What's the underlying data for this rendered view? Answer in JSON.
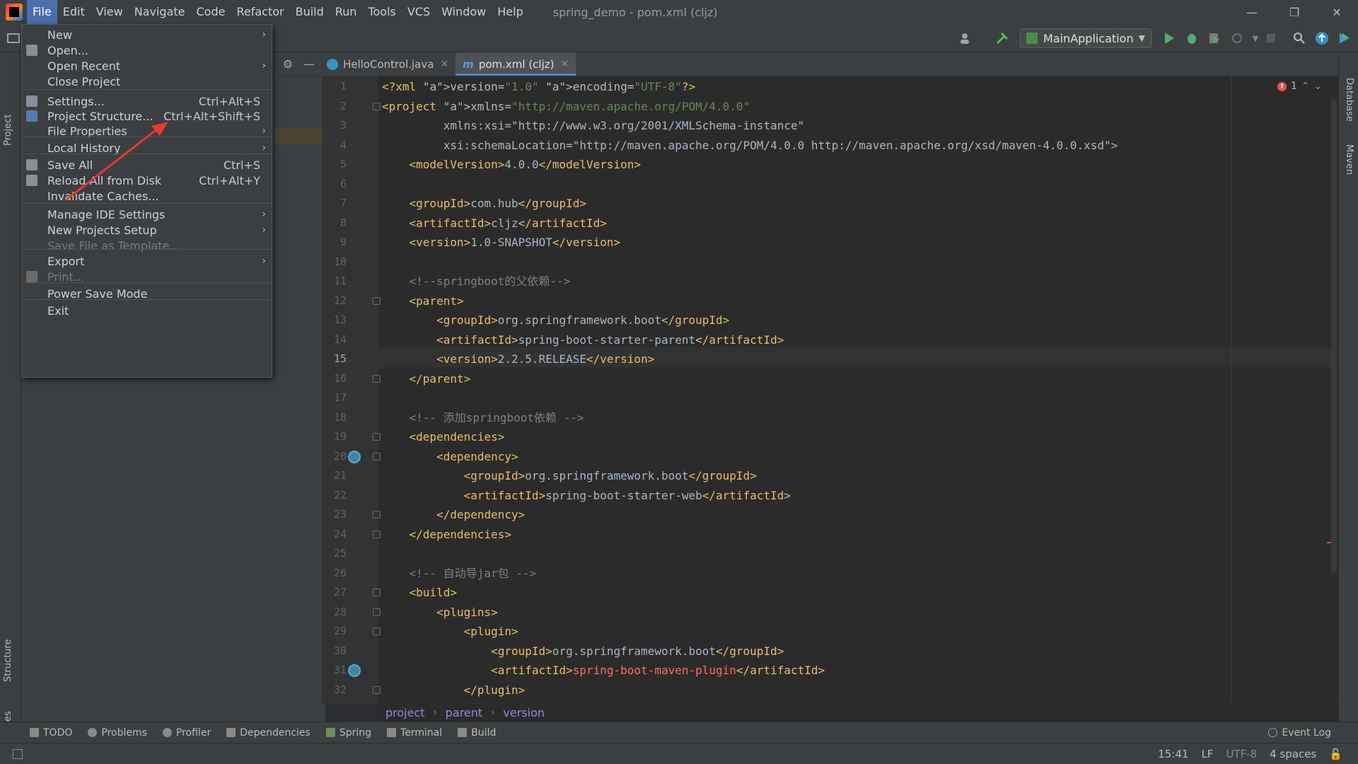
{
  "app": {
    "title": "spring_demo - pom.xml (cljz)",
    "menubar": [
      "File",
      "Edit",
      "View",
      "Navigate",
      "Code",
      "Refactor",
      "Build",
      "Run",
      "Tools",
      "VCS",
      "Window",
      "Help"
    ],
    "active_menu": "File"
  },
  "window_controls": {
    "minimize": "—",
    "restore": "❐",
    "close": "✕"
  },
  "toolbar": {
    "run_config": "MainApplication"
  },
  "side_tabs": {
    "left": [
      "Project",
      "Structure",
      "Favorites"
    ],
    "right": [
      "Database",
      "Maven"
    ]
  },
  "file_menu": {
    "items": [
      {
        "label": "New",
        "shortcut": "",
        "submenu": true,
        "disabled": false,
        "icon": ""
      },
      {
        "label": "Open...",
        "shortcut": "",
        "submenu": false,
        "disabled": false,
        "icon": "folder-icon"
      },
      {
        "label": "Open Recent",
        "shortcut": "",
        "submenu": true,
        "disabled": false,
        "icon": ""
      },
      {
        "label": "Close Project",
        "shortcut": "",
        "submenu": false,
        "disabled": false,
        "icon": ""
      },
      {
        "label": "Settings...",
        "shortcut": "Ctrl+Alt+S",
        "submenu": false,
        "disabled": false,
        "icon": "wrench-icon"
      },
      {
        "label": "Project Structure...",
        "shortcut": "Ctrl+Alt+Shift+S",
        "submenu": false,
        "disabled": false,
        "icon": "structure-icon"
      },
      {
        "label": "File Properties",
        "shortcut": "",
        "submenu": true,
        "disabled": false,
        "icon": ""
      },
      {
        "label": "Local History",
        "shortcut": "",
        "submenu": true,
        "disabled": false,
        "icon": ""
      },
      {
        "label": "Save All",
        "shortcut": "Ctrl+S",
        "submenu": false,
        "disabled": false,
        "icon": "save-icon"
      },
      {
        "label": "Reload All from Disk",
        "shortcut": "Ctrl+Alt+Y",
        "submenu": false,
        "disabled": false,
        "icon": "reload-icon"
      },
      {
        "label": "Invalidate Caches...",
        "shortcut": "",
        "submenu": false,
        "disabled": false,
        "icon": ""
      },
      {
        "label": "Manage IDE Settings",
        "shortcut": "",
        "submenu": true,
        "disabled": false,
        "icon": ""
      },
      {
        "label": "New Projects Setup",
        "shortcut": "",
        "submenu": true,
        "disabled": false,
        "icon": ""
      },
      {
        "label": "Save File as Template...",
        "shortcut": "",
        "submenu": false,
        "disabled": true,
        "icon": ""
      },
      {
        "label": "Export",
        "shortcut": "",
        "submenu": true,
        "disabled": false,
        "icon": ""
      },
      {
        "label": "Print...",
        "shortcut": "",
        "submenu": false,
        "disabled": true,
        "icon": "print-icon"
      },
      {
        "label": "Power Save Mode",
        "shortcut": "",
        "submenu": false,
        "disabled": false,
        "icon": ""
      },
      {
        "label": "Exit",
        "shortcut": "",
        "submenu": false,
        "disabled": false,
        "icon": ""
      }
    ]
  },
  "tabs": [
    {
      "label": "HelloControl.java",
      "selected": false
    },
    {
      "label": "pom.xml (cljz)",
      "selected": true
    }
  ],
  "editor": {
    "current_line": 15,
    "error_count": "1",
    "lines": [
      "<?xml version=\"1.0\" encoding=\"UTF-8\"?>",
      "<project xmlns=\"http://maven.apache.org/POM/4.0.0\"",
      "         xmlns:xsi=\"http://www.w3.org/2001/XMLSchema-instance\"",
      "         xsi:schemaLocation=\"http://maven.apache.org/POM/4.0.0 http://maven.apache.org/xsd/maven-4.0.0.xsd\">",
      "    <modelVersion>4.0.0</modelVersion>",
      "",
      "    <groupId>com.hub</groupId>",
      "    <artifactId>cljz</artifactId>",
      "    <version>1.0-SNAPSHOT</version>",
      "",
      "    <!--springboot的父依赖-->",
      "    <parent>",
      "        <groupId>org.springframework.boot</groupId>",
      "        <artifactId>spring-boot-starter-parent</artifactId>",
      "        <version>2.2.5.RELEASE</version>",
      "    </parent>",
      "",
      "    <!-- 添加springboot依赖 -->",
      "    <dependencies>",
      "        <dependency>",
      "            <groupId>org.springframework.boot</groupId>",
      "            <artifactId>spring-boot-starter-web</artifactId>",
      "        </dependency>",
      "    </dependencies>",
      "",
      "    <!-- 自动导jar包 -->",
      "    <build>",
      "        <plugins>",
      "            <plugin>",
      "                <groupId>org.springframework.boot</groupId>",
      "                <artifactId>spring-boot-maven-plugin</artifactId>",
      "            </plugin>"
    ]
  },
  "breadcrumb": [
    "project",
    "parent",
    "version"
  ],
  "bottom_tools": [
    "TODO",
    "Problems",
    "Profiler",
    "Dependencies",
    "Spring",
    "Terminal",
    "Build"
  ],
  "event_log": "Event Log",
  "status": {
    "position": "15:41",
    "line_sep": "LF",
    "encoding": "UTF-8",
    "indent": "4 spaces"
  },
  "colors": {
    "accent": "#4b6eaf",
    "tag": "#e8bf6a",
    "string": "#6a8759",
    "comment": "#808080",
    "annotation_arrow": "#e53935"
  }
}
